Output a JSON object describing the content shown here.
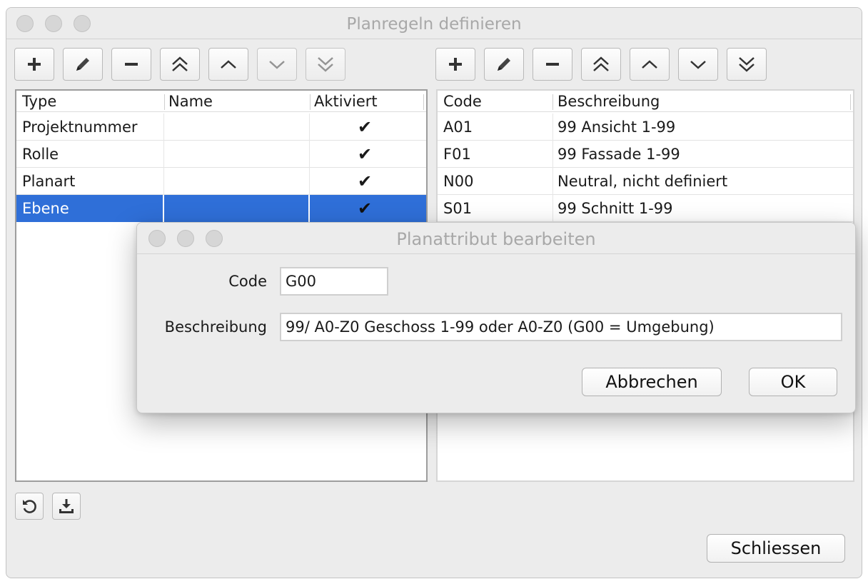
{
  "window": {
    "title": "Planregeln definieren"
  },
  "left_table": {
    "columns": [
      "Type",
      "Name",
      "Aktiviert"
    ],
    "rows": [
      {
        "type": "Projektnummer",
        "name": "",
        "checked": "✔"
      },
      {
        "type": "Rolle",
        "name": "",
        "checked": "✔"
      },
      {
        "type": "Planart",
        "name": "",
        "checked": "✔"
      },
      {
        "type": "Ebene",
        "name": "",
        "checked": "✔",
        "selected": true
      }
    ]
  },
  "right_table": {
    "columns": [
      "Code",
      "Beschreibung"
    ],
    "rows": [
      {
        "code": "A01",
        "desc": "99 Ansicht 1-99"
      },
      {
        "code": "F01",
        "desc": "99 Fassade 1-99"
      },
      {
        "code": "N00",
        "desc": "Neutral, nicht definiert"
      },
      {
        "code": "S01",
        "desc": "99 Schnitt 1-99"
      }
    ]
  },
  "toolbar_icons": [
    "plus-icon",
    "pencil-icon",
    "minus-icon",
    "double-chevron-up-icon",
    "chevron-up-icon",
    "chevron-down-icon",
    "double-chevron-down-icon"
  ],
  "bottom": {
    "close_label": "Schliessen"
  },
  "dialog": {
    "title": "Planattribut bearbeiten",
    "code_label": "Code",
    "code_value": "G00",
    "desc_label": "Beschreibung",
    "desc_value": "99/ A0-Z0 Geschoss 1-99 oder A0-Z0 (G00 = Umgebung)",
    "cancel_label": "Abbrechen",
    "ok_label": "OK"
  },
  "colors": {
    "selection": "#2f6fd8",
    "window_bg": "#ececec"
  }
}
